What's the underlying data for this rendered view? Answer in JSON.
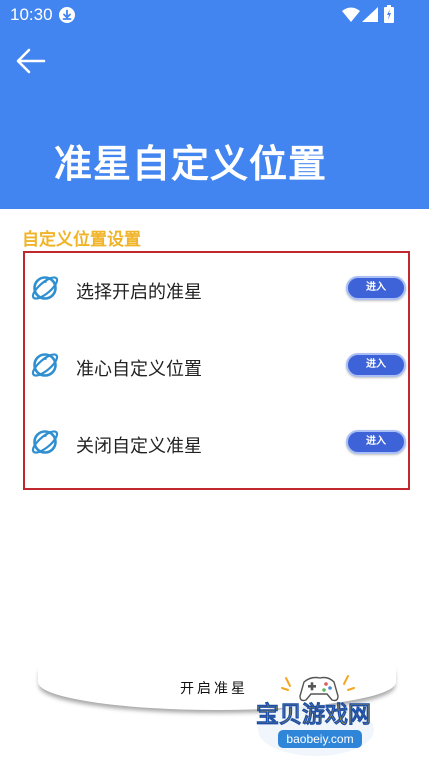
{
  "status_bar": {
    "time": "10:30",
    "icons": [
      "download-icon",
      "wifi-icon",
      "signal-icon",
      "battery-icon"
    ]
  },
  "header": {
    "back_icon": "back-arrow-icon",
    "title": "准星自定义位置"
  },
  "section": {
    "title": "自定义位置设置",
    "items": [
      {
        "label": "选择开启的准星",
        "button": "进入",
        "icon": "planet-icon"
      },
      {
        "label": "准心自定义位置",
        "button": "进入",
        "icon": "planet-icon"
      },
      {
        "label": "关闭自定义准星",
        "button": "进入",
        "icon": "planet-icon"
      }
    ]
  },
  "bottom": {
    "button_label": "开启准星"
  },
  "watermark": {
    "brand": "宝贝游戏网",
    "url": "baobeiy.com"
  },
  "colors": {
    "primary": "#4285f0",
    "section_title": "#f0b429",
    "panel_border": "#c0282d",
    "enter_button": "#3e63d8",
    "icon_blue": "#2f8fd0"
  }
}
